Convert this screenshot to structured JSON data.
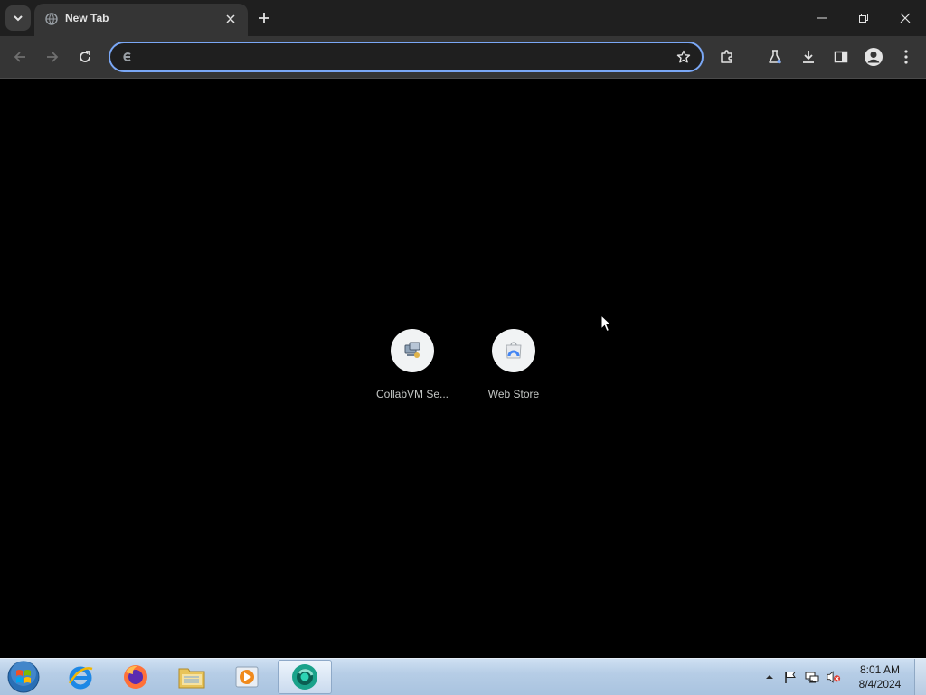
{
  "browser": {
    "tab": {
      "title": "New Tab"
    },
    "window_controls": {
      "minimize": "minimize",
      "restore": "restore",
      "close": "close"
    },
    "omnibox": {
      "value": "",
      "placeholder": ""
    },
    "toolbar_icons": [
      "arrow-left-icon",
      "arrow-right-icon",
      "reload-icon",
      "star-icon",
      "extensions-icon",
      "labs-flask-icon",
      "download-icon",
      "side-panel-icon",
      "profile-icon",
      "kebab-menu-icon"
    ]
  },
  "new_tab_page": {
    "shortcuts": [
      {
        "label": "CollabVM Se...",
        "icon": "collabvm-icon"
      },
      {
        "label": "Web Store",
        "icon": "web-store-icon"
      }
    ]
  },
  "taskbar": {
    "apps": [
      "internet-explorer-icon",
      "firefox-icon",
      "file-explorer-icon",
      "media-player-icon",
      "chrome-app-icon"
    ],
    "clock": {
      "time": "8:01 AM",
      "date": "8/4/2024"
    }
  },
  "colors": {
    "accent": "#7aa7f5",
    "tabstrip": "#1f1f1f",
    "toolbar": "#353535",
    "page_background": "#000000"
  }
}
